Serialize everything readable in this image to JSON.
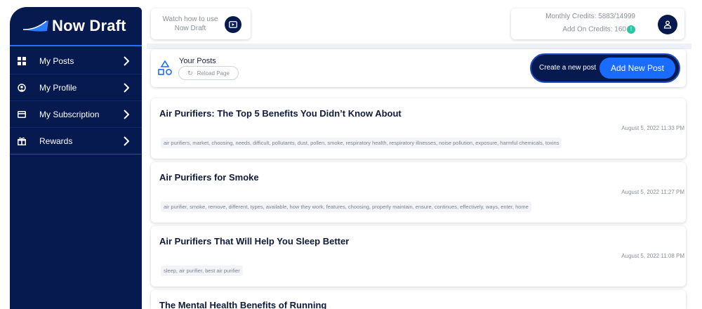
{
  "brand": {
    "name": "Now Draft",
    "colors": {
      "sidebar": "#061a4f",
      "accent": "#1a6cff",
      "badge": "#2ec4a6"
    }
  },
  "sidebar": {
    "items": [
      {
        "label": "My Posts",
        "icon": "grid-icon"
      },
      {
        "label": "My Profile",
        "icon": "user-circle-icon"
      },
      {
        "label": "My Subscription",
        "icon": "credit-card-icon"
      },
      {
        "label": "Rewards",
        "icon": "gift-icon"
      }
    ]
  },
  "tutorial": {
    "line1": "Watch how to use",
    "line2": "Now Draft",
    "icon": "play-icon"
  },
  "credits": {
    "monthly_label": "Monthly Credits: 5883/14999",
    "addon_label": "Add On Credits: 160",
    "addon_badge": "!"
  },
  "posts_header": {
    "title": "Your Posts",
    "reload_label": "Reload Page",
    "create_text": "Create a new post",
    "add_label": "Add New Post"
  },
  "posts": [
    {
      "title": "Air Purifiers: The Top 5 Benefits You Didn’t Know About",
      "date": "August 5, 2022 11:33 PM",
      "tags": "air purifiers, market, choosing, needs, difficult, pollutants, dust, pollen, smoke, respiratory health, respiratory illnesses, noise pollution, exposure, harmful chemicals, toxins"
    },
    {
      "title": "Air Purifiers for Smoke",
      "date": "August 5, 2022 11:27 PM",
      "tags": "air purifier, smoke, remove, different, types, available, how they work, features, choosing, properly maintain, ensure, continues, effectively, ways, enter, home"
    },
    {
      "title": "Air Purifiers That Will Help You Sleep Better",
      "date": "August 5, 2022 11:08 PM",
      "tags": "sleep, air purifier, best air purifier"
    },
    {
      "title": "The Mental Health Benefits of Running",
      "date": "",
      "tags": ""
    }
  ]
}
